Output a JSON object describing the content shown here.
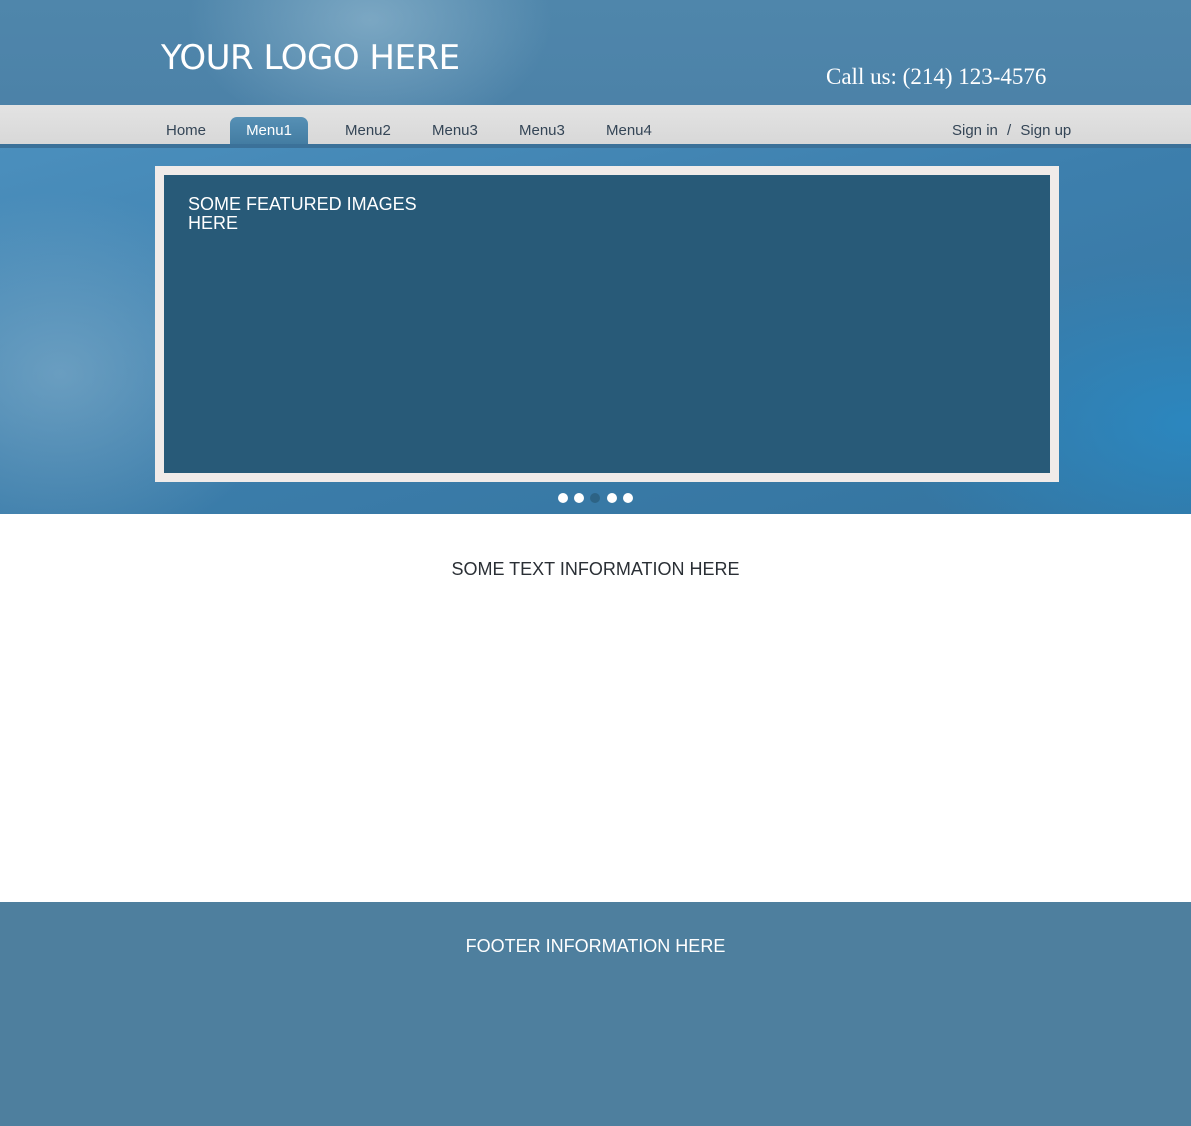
{
  "header": {
    "logo_text": "YOUR LOGO HERE",
    "phone_text": "Call us: (214) 123-4576"
  },
  "nav": {
    "items": [
      {
        "label": "Home",
        "active": false
      },
      {
        "label": "Menu1",
        "active": true
      },
      {
        "label": "Menu2",
        "active": false
      },
      {
        "label": "Menu3",
        "active": false
      },
      {
        "label": "Menu3",
        "active": false
      },
      {
        "label": "Menu4",
        "active": false
      }
    ],
    "sign_in": "Sign in",
    "separator": "/",
    "sign_up": "Sign up"
  },
  "hero": {
    "caption": "SOME FEATURED IMAGES HERE",
    "slide_count": 5,
    "active_slide": 3
  },
  "content": {
    "text": "SOME TEXT INFORMATION HERE"
  },
  "footer": {
    "text": "FOOTER INFORMATION HERE"
  },
  "colors": {
    "header_blue": "#4f86ab",
    "nav_gray": "#d8d8d8",
    "active_tab": "#4a84aa",
    "slider_panel": "#285a78",
    "slider_frame": "#f0ebe9",
    "footer_blue": "#4e7f9e"
  }
}
